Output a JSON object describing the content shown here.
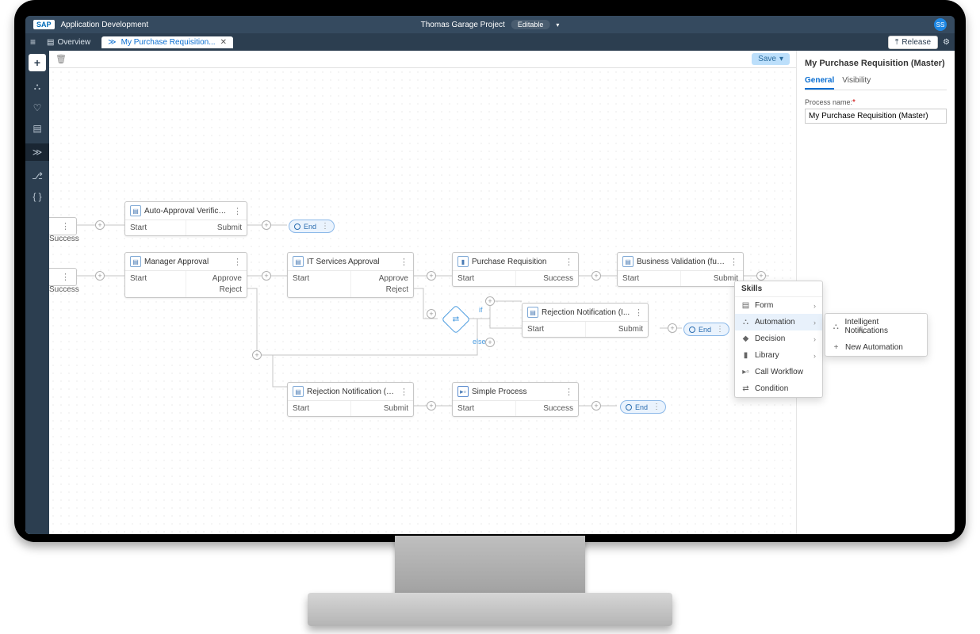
{
  "header": {
    "logo": "SAP",
    "app_title": "Application Development",
    "project": "Thomas Garage Project",
    "editable_label": "Editable",
    "avatar_initials": "SS"
  },
  "subheader": {
    "overview_tab": "Overview",
    "active_tab": "My Purchase Requisition...",
    "release_label": "Release"
  },
  "toolbar": {
    "save_label": "Save"
  },
  "panel": {
    "title": "My Purchase Requisition (Master)",
    "tab_general": "General",
    "tab_visibility": "Visibility",
    "process_name_label": "Process name:",
    "process_name_value": "My Purchase Requisition (Master)"
  },
  "labels": {
    "start": "Start",
    "submit": "Submit",
    "approve": "Approve",
    "reject": "Reject",
    "success": "Success",
    "end": "End",
    "if": "if",
    "else": "else"
  },
  "nodes": {
    "auto_approval": "Auto-Approval Verificatio...",
    "manager_approval": "Manager Approval",
    "it_services": "IT Services Approval",
    "purchase_req": "Purchase Requisition",
    "business_validation": "Business Validation (full...",
    "rejection_notif_i": "Rejection Notification (I...",
    "rejection_notif_m": "Rejection Notification (M...",
    "simple_process": "Simple Process"
  },
  "skills_menu": {
    "title": "Skills",
    "form": "Form",
    "automation": "Automation",
    "decision": "Decision",
    "library": "Library",
    "call_workflow": "Call Workflow",
    "condition": "Condition"
  },
  "automation_submenu": {
    "intelligent": "Intelligent Notifications",
    "new_auto": "New Automation"
  }
}
